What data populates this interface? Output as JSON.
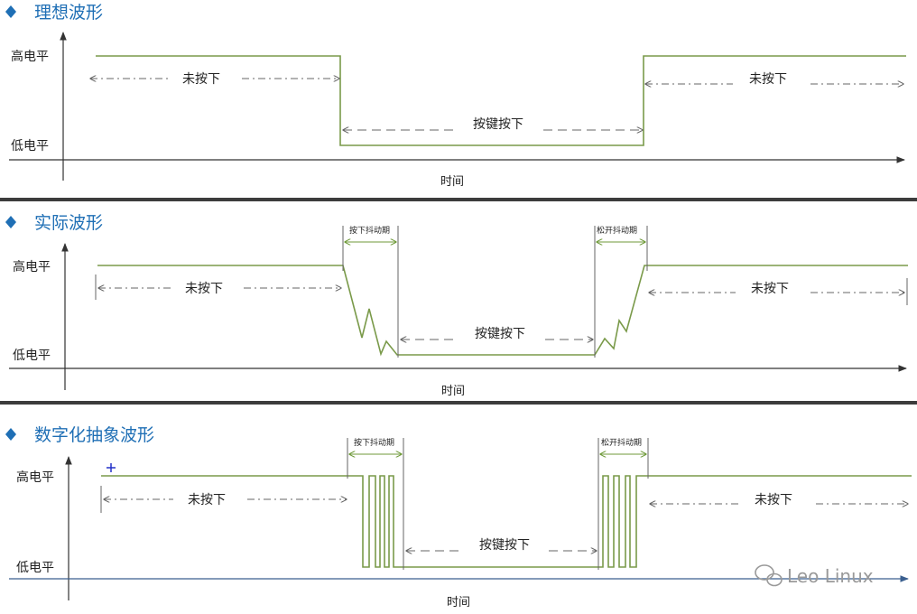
{
  "sections": [
    {
      "title": "理想波形"
    },
    {
      "title": "实际波形"
    },
    {
      "title": "数字化抽象波形"
    }
  ],
  "labels": {
    "high": "高电平",
    "low": "低电平",
    "time": "时间",
    "not_pressed": "未按下",
    "pressed": "按键按下",
    "press_bounce": "按下抖动期",
    "release_bounce": "松开抖动期"
  },
  "watermark": "Leo Linux",
  "colors": {
    "title": "#1f6fb5",
    "wave": "#7a9a4a",
    "axis": "#333333",
    "separator": "#3c3c3c"
  }
}
